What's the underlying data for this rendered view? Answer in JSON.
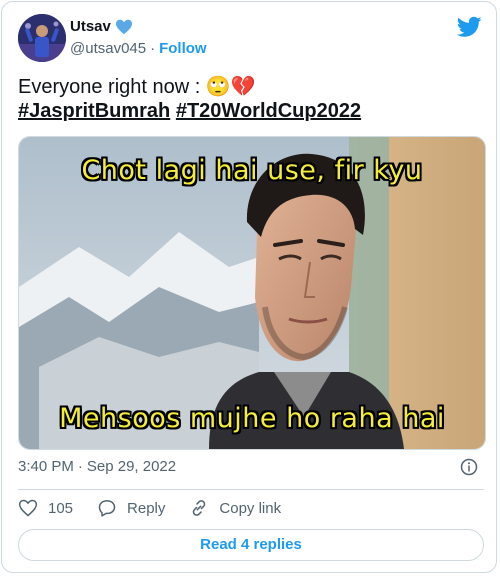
{
  "author": {
    "name": "Utsav",
    "handle": "@utsav045",
    "separator": "·",
    "follow_label": "Follow",
    "verified_icon": "blue-heart-icon"
  },
  "tweet": {
    "text_prefix": "Everyone right now : ",
    "emojis": "🙄💔",
    "hashtags": [
      "#JaspritBumrah",
      "#T20WorldCup2022"
    ]
  },
  "media": {
    "top_caption": "Chot lagi hai use, fir kyu",
    "bottom_caption": "Mehsoos mujhe ho raha hai"
  },
  "meta": {
    "time": "3:40 PM",
    "separator": "·",
    "date": "Sep 29, 2022"
  },
  "actions": {
    "like_count": "105",
    "reply_label": "Reply",
    "copy_label": "Copy link"
  },
  "read_replies_label": "Read 4 replies",
  "colors": {
    "accent": "#1d9bf0",
    "text": "#0f1419",
    "muted": "#536471",
    "border": "#cfd9de",
    "meme_text": "#f4ee3b"
  }
}
